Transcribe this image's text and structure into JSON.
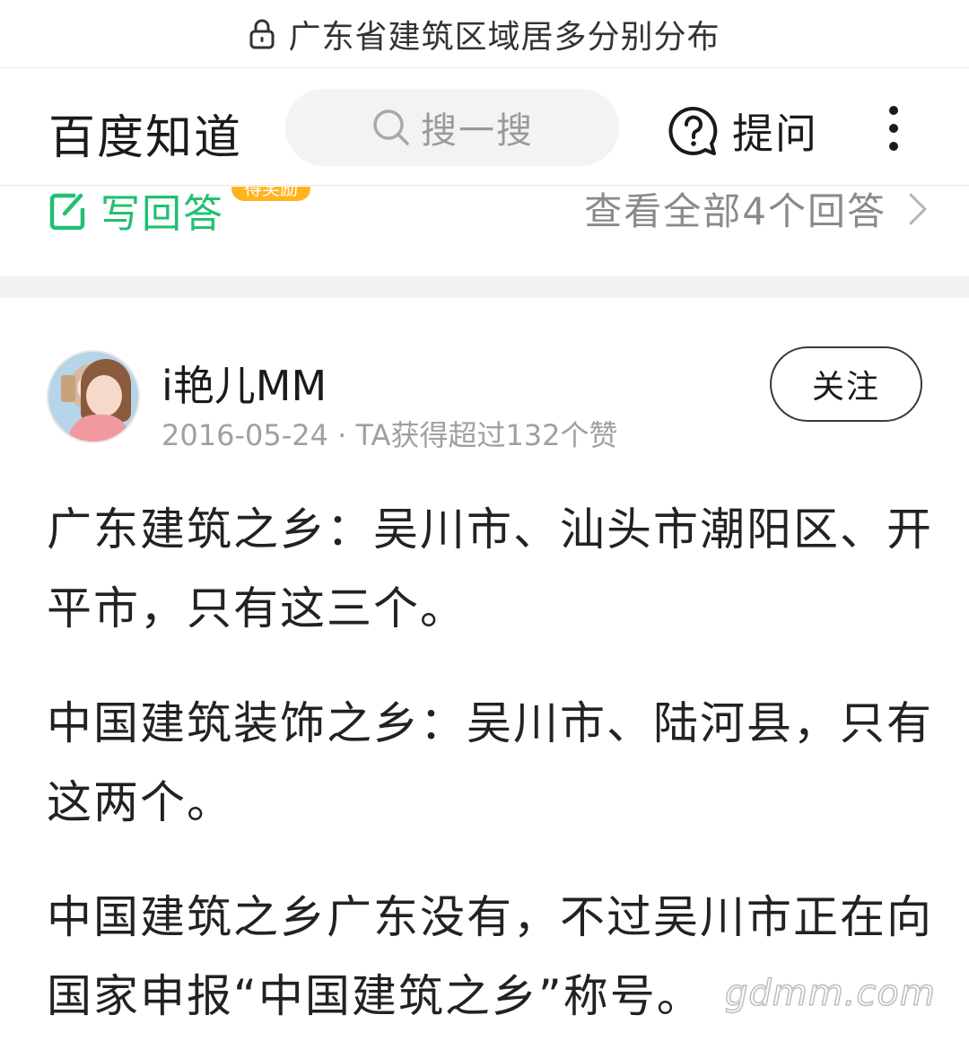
{
  "browser": {
    "page_title": "广东省建筑区域居多分别分布"
  },
  "header": {
    "brand": "百度知道",
    "search_placeholder": "搜一搜",
    "ask_label": "提问"
  },
  "answer_strip": {
    "write_answer_label": "写回答",
    "reward_badge": "得奖励",
    "view_all_label": "查看全部4个回答"
  },
  "author": {
    "name": "i艳儿MM",
    "meta": "2016-05-24 · TA获得超过132个赞",
    "follow_label": "关注"
  },
  "answer": {
    "paragraphs": [
      "广东建筑之乡：吴川市、汕头市潮阳区、开平市，只有这三个。",
      "中国建筑装饰之乡：吴川市、陆河县，只有这两个。",
      "中国建筑之乡广东没有，不过吴川市正在向国家申报“中国建筑之乡”称号。"
    ]
  },
  "watermark": "gdmm.com",
  "colors": {
    "accent_green": "#20c070",
    "badge_orange": "#ffb41e",
    "meta_gray": "#a0a0a0"
  }
}
